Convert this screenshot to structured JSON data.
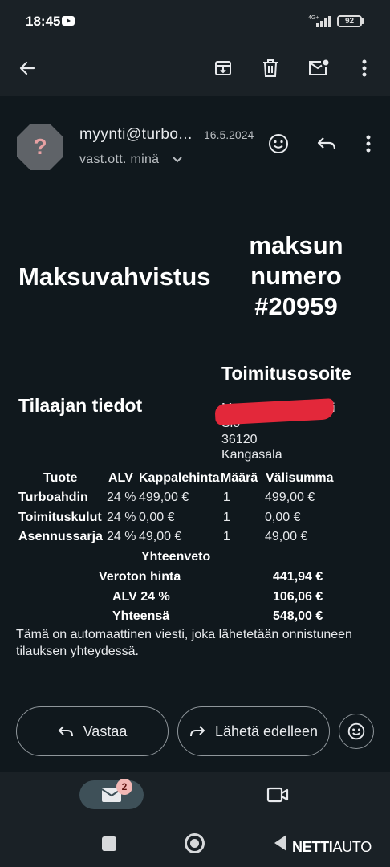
{
  "status_bar": {
    "time": "18:45",
    "network": "4G+",
    "battery": "92"
  },
  "toolbar": {
    "back_icon": "arrow-back-icon",
    "archive_icon": "archive-icon",
    "delete_icon": "trash-icon",
    "mark_unread_icon": "mail-unread-icon",
    "more_icon": "more-vert-icon"
  },
  "email": {
    "sender": "myynti@turbo...",
    "date": "16.5.2024",
    "recipient": "vast.ott. minä",
    "avatar_symbol": "?",
    "title_left": "Maksuvahvistus",
    "title_right": [
      "maksun",
      "numero",
      "#20959"
    ],
    "buyer_heading": "Tilaajan tiedot",
    "delivery_heading": "Toimitusosoite",
    "address_lines": [
      "M",
      "ki",
      "Slo",
      "36120",
      "Kangasala"
    ],
    "table": {
      "headers": [
        "Tuote",
        "ALV",
        "Kappalehinta",
        "Määrä",
        "Välisumma"
      ],
      "rows": [
        {
          "product": "Turboahdin",
          "vat": "24 %",
          "unit_price": "499,00 €",
          "qty": "1",
          "subtotal": "499,00 €"
        },
        {
          "product": "Toimituskulut",
          "vat": "24 %",
          "unit_price": "0,00 €",
          "qty": "1",
          "subtotal": "0,00 €"
        },
        {
          "product": "Asennussarja",
          "vat": "24 %",
          "unit_price": "49,00 €",
          "qty": "1",
          "subtotal": "49,00 €"
        }
      ]
    },
    "summary": {
      "heading": "Yhteenveto",
      "rows": [
        {
          "label": "Veroton hinta",
          "value": "441,94 €"
        },
        {
          "label": "ALV 24 %",
          "value": "106,06 €"
        },
        {
          "label": "Yhteensä",
          "value": "548,00 €"
        }
      ]
    },
    "footnote": "Tämä on automaattinen viesti, joka lähetetään onnistuneen tilauksen yhteydessä."
  },
  "actions": {
    "reply": "Vastaa",
    "forward": "Lähetä edelleen"
  },
  "bottom_nav": {
    "mail_badge": "2"
  },
  "watermark": {
    "part1": "NETTI",
    "part2": "AUTO"
  },
  "colors": {
    "background": "#10181d",
    "bar": "#1a2126",
    "redaction": "#e3283a",
    "badge": "#f2b8b5"
  }
}
